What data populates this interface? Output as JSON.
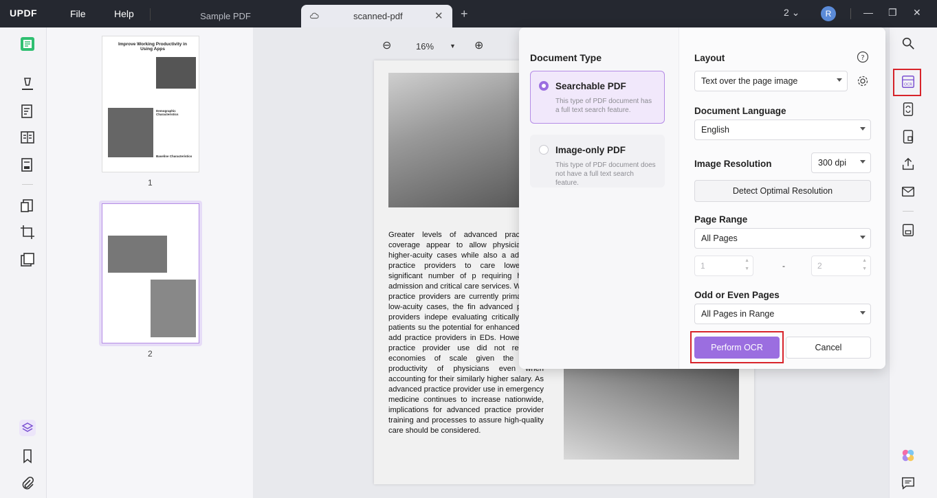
{
  "titlebar": {
    "logo": "UPDF",
    "menu_file": "File",
    "menu_help": "Help",
    "tabs": [
      {
        "label": "Sample PDF",
        "active": false
      },
      {
        "label": "scanned-pdf",
        "active": true
      }
    ],
    "window_count": "2",
    "avatar_letter": "R"
  },
  "thumbnails": {
    "pages": [
      {
        "number": "1",
        "heading": "Improve Working Productivity in Using Apps",
        "subheading": "Demographic Characteristics",
        "subheading2": "Baseline Characteristics"
      },
      {
        "number": "2"
      }
    ]
  },
  "viewer": {
    "zoom": "16%",
    "page_text": "Greater levels of advanced practice p coverage appear to allow physicians for higher-acuity cases while also a advanced practice providers to care lower, but significant number of p requiring hospital admission and critical care services. While ad practice providers are currently primarily for low-acuity cases, the fin advanced practice providers indepe evaluating critically ill ED patients su the potential for enhanced use of add practice providers in EDs. However, ad practice provider use did not result in economies of scale given the higher productivity of physicians even when accounting for their similarly higher salary. As advanced practice provider use in emergency medicine continues to increase nationwide, implications for advanced practice provider training and processes to assure high-quality care should be considered."
  },
  "ocr_dialog": {
    "document_type_title": "Document Type",
    "options": [
      {
        "label": "Searchable PDF",
        "description": "This type of PDF document has a full text search feature.",
        "selected": true
      },
      {
        "label": "Image-only PDF",
        "description": "This type of PDF document does not have a full text search feature.",
        "selected": false
      }
    ],
    "layout_label": "Layout",
    "layout_value": "Text over the page image",
    "language_label": "Document Language",
    "language_value": "English",
    "resolution_label": "Image Resolution",
    "resolution_value": "300 dpi",
    "detect_button": "Detect Optimal Resolution",
    "page_range_label": "Page Range",
    "page_range_value": "All Pages",
    "range_from": "1",
    "range_separator": "-",
    "range_to": "2",
    "odd_even_label": "Odd or Even Pages",
    "odd_even_value": "All Pages in Range",
    "perform_button": "Perform OCR",
    "cancel_button": "Cancel"
  },
  "colors": {
    "accent": "#9b6ee0",
    "highlight": "#d8232a",
    "titlebar": "#252830"
  }
}
